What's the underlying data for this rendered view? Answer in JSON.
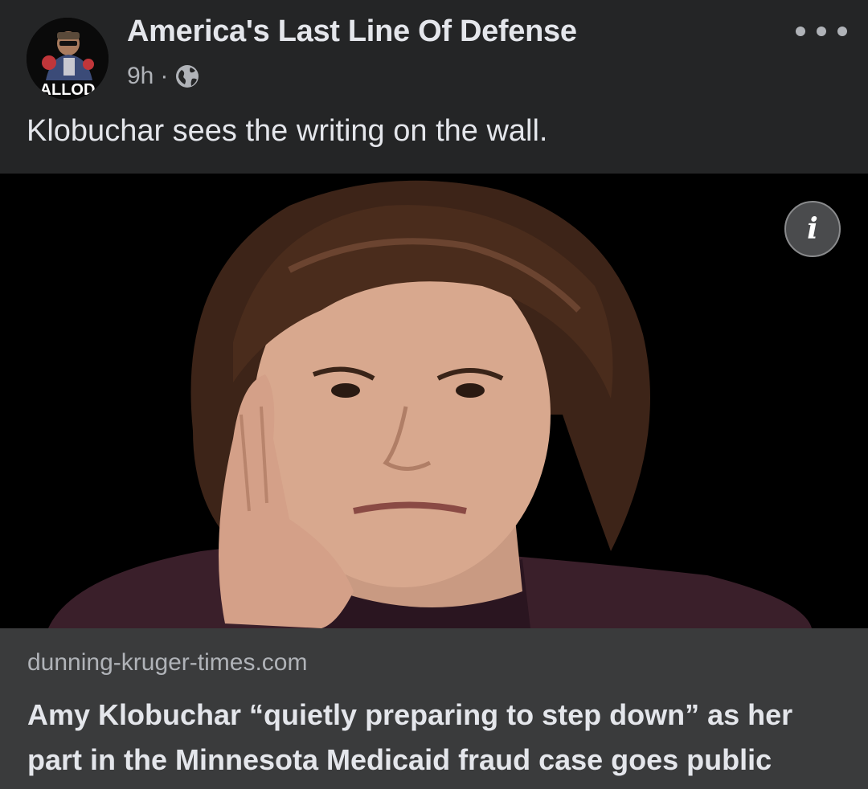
{
  "post": {
    "page_name": "America's Last Line Of Defense",
    "avatar_label": "ALLOD",
    "timestamp": "9h",
    "separator": "·",
    "audience_icon": "globe-icon",
    "more_icon": "more-options-icon",
    "caption": "Klobuchar sees the writing on the wall."
  },
  "link_preview": {
    "info_icon": "info-icon",
    "info_glyph": "i",
    "domain": "dunning-kruger-times.com",
    "headline": "Amy Klobuchar “quietly preparing to step down” as her part in the Minnesota Medicaid fraud case goes public"
  },
  "colors": {
    "background": "#242526",
    "link_info_background": "#3a3b3c",
    "primary_text": "#e4e6eb",
    "secondary_text": "#b0b3b8"
  }
}
